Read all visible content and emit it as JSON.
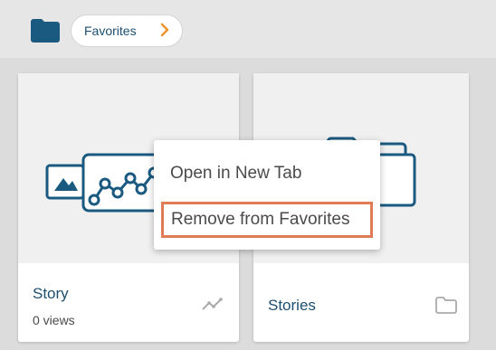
{
  "breadcrumb": {
    "label": "Favorites"
  },
  "cards": [
    {
      "title": "Story",
      "views": "0 views",
      "icon": "trend-icon"
    },
    {
      "title": "Stories",
      "icon": "folder-outline-icon"
    }
  ],
  "context_menu": {
    "items": [
      {
        "label": "Open in New Tab"
      },
      {
        "label": "Remove from Favorites",
        "highlighted": true
      }
    ]
  },
  "colors": {
    "accent": "#1d4f6e",
    "folder": "#1a5a80",
    "highlight": "#e07b55",
    "chevron": "#f0922b"
  }
}
